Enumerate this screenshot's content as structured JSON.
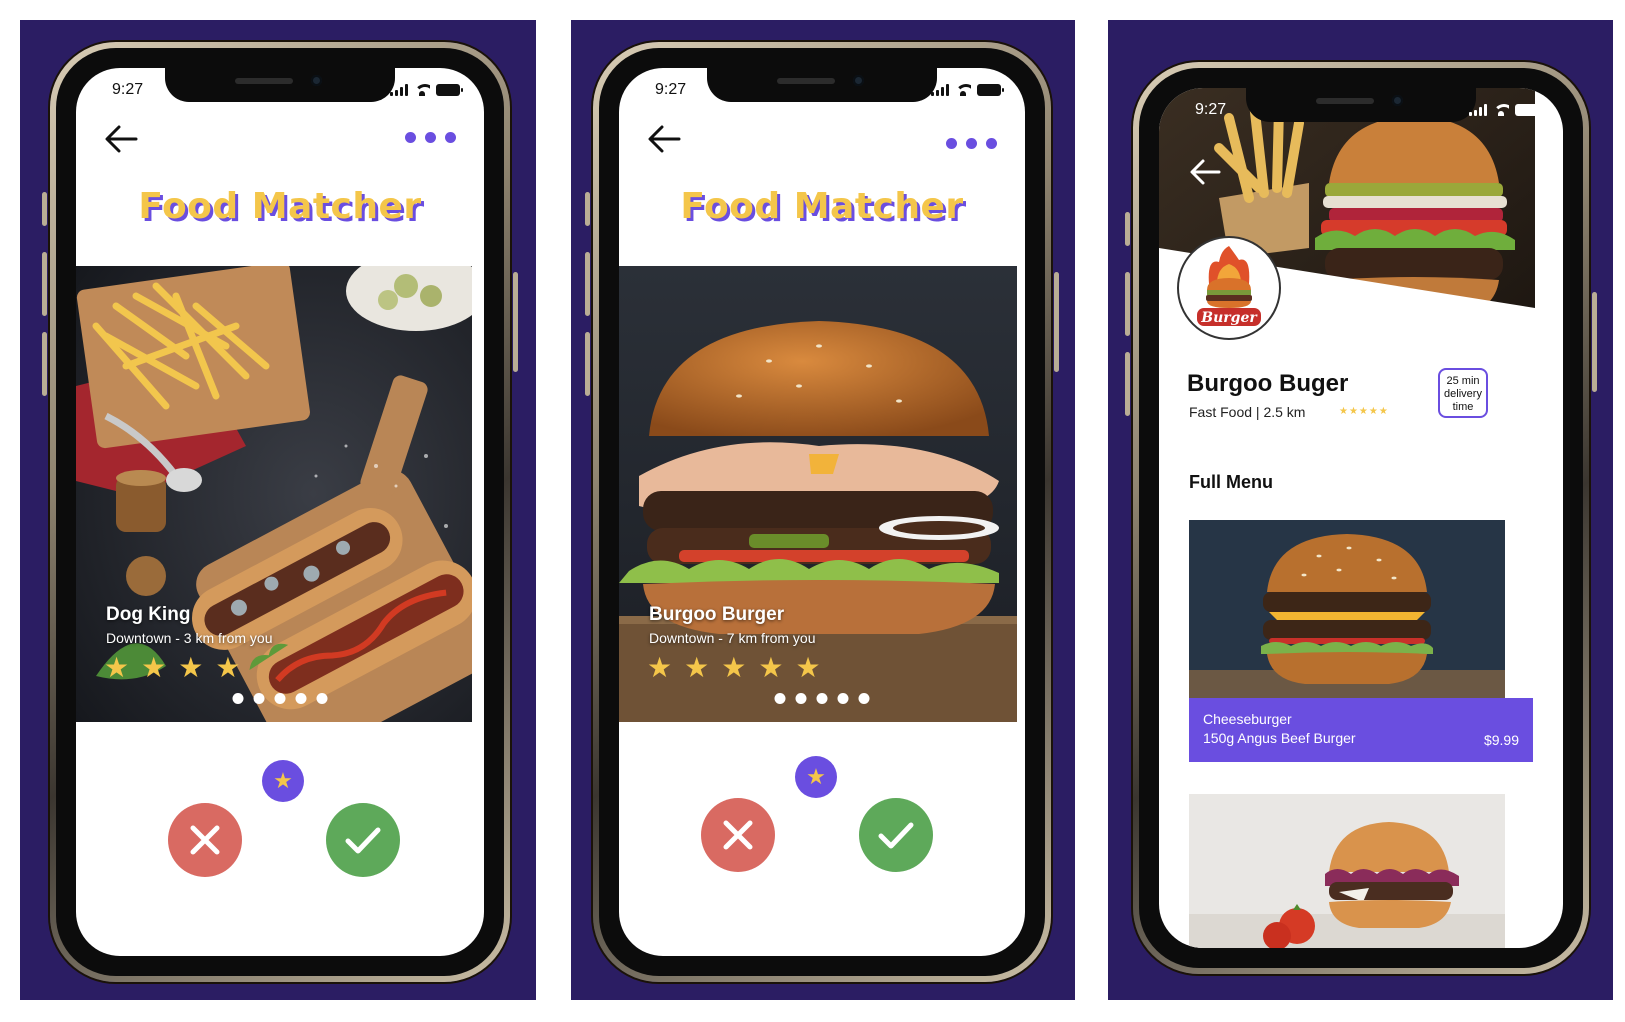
{
  "colors": {
    "background_panel": "#2b1d63",
    "accent": "#6a4ee0",
    "gold": "#f4c64a",
    "reject": "#d96a62",
    "accept": "#5ea95a"
  },
  "screen1": {
    "status_time": "9:27",
    "title": "Food Matcher",
    "card": {
      "name": "Dog King",
      "subtitle": "Downtown - 3 km from you",
      "rating": 4,
      "star_glyph": "★"
    },
    "dots": 5,
    "icons": [
      "back-arrow-icon",
      "more-dots-icon",
      "star-icon",
      "close-icon",
      "check-icon"
    ]
  },
  "screen2": {
    "status_time": "9:27",
    "title": "Food Matcher",
    "card": {
      "name": "Burgoo Burger",
      "subtitle": "Downtown - 7 km from you",
      "rating": 5,
      "star_glyph": "★"
    },
    "dots": 5
  },
  "screen3": {
    "status_time": "9:27",
    "logo_text": "Burger",
    "restaurant": {
      "name": "Burgoo Buger",
      "meta": "Fast Food | 2.5 km",
      "stars": "★★★★★"
    },
    "delivery": {
      "line1": "25 min",
      "line2": "delivery",
      "line3": "time"
    },
    "section_title": "Full Menu",
    "menu_item": {
      "name": "Cheeseburger",
      "description": "150g Angus Beef Burger",
      "price": "$9.99"
    }
  }
}
